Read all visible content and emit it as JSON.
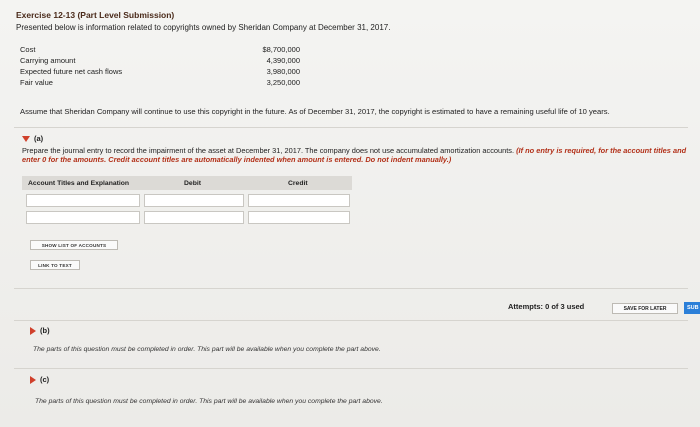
{
  "header": {
    "title": "Exercise 12-13 (Part Level Submission)",
    "intro": "Presented below is information related to copyrights owned by Sheridan Company at December 31, 2017."
  },
  "financials": [
    {
      "label": "Cost",
      "value": "$8,700,000"
    },
    {
      "label": "Carrying amount",
      "value": "4,390,000"
    },
    {
      "label": "Expected future net cash flows",
      "value": "3,980,000"
    },
    {
      "label": "Fair value",
      "value": "3,250,000"
    }
  ],
  "assumption": "Assume that Sheridan Company will continue to use this copyright in the future. As of December 31, 2017, the copyright is estimated to have a remaining useful life of 10 years.",
  "part_a": {
    "label": "(a)",
    "instruction": "Prepare the journal entry to record the impairment of the asset at December 31, 2017. The company does not use accumulated amortization accounts.",
    "instruction_note": "(If no entry is required, for the account titles and enter 0 for the amounts. Credit account titles are automatically indented when amount is entered. Do not indent manually.)",
    "columns": {
      "account": "Account Titles and Explanation",
      "debit": "Debit",
      "credit": "Credit"
    },
    "show_accounts_label": "SHOW LIST OF ACCOUNTS",
    "link_text_label": "LINK TO TEXT"
  },
  "footer": {
    "attempts": "Attempts: 0 of 3 used",
    "save_label": "SAVE FOR LATER",
    "submit_label": "SUB"
  },
  "part_b": {
    "label": "(b)",
    "note": "The parts of this question must be completed in order. This part will be available when you complete the part above."
  },
  "part_c": {
    "label": "(c)",
    "note": "The parts of this question must be completed in order. This part will be available when you complete the part above."
  }
}
